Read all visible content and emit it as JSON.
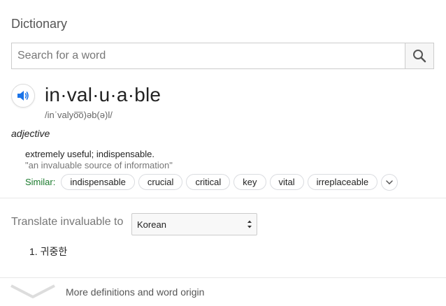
{
  "header": {
    "title": "Dictionary"
  },
  "search": {
    "placeholder": "Search for a word",
    "value": ""
  },
  "entry": {
    "word": "in·val·u·a·ble",
    "phonetic": "/inˈvalyo͞o)əb(ə)l/",
    "part_of_speech": "adjective",
    "definition": "extremely useful; indispensable.",
    "example": "\"an invaluable source of information\"",
    "similar_label": "Similar:",
    "similar": [
      "indispensable",
      "crucial",
      "critical",
      "key",
      "vital",
      "irreplaceable"
    ]
  },
  "translate": {
    "label": "Translate invaluable to",
    "selected_language": "Korean",
    "results": [
      "1. 귀중한"
    ]
  },
  "footer": {
    "more_label": "More definitions and word origin"
  },
  "colors": {
    "similar_label": "#1a7a2c",
    "speaker_icon": "#1a73e8"
  }
}
